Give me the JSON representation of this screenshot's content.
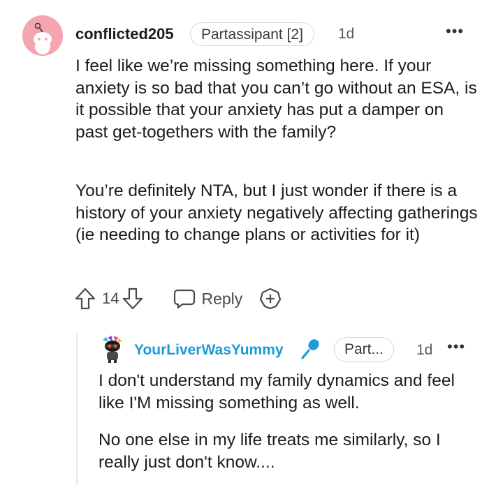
{
  "comment": {
    "username": "conflicted205",
    "flair": "Partassipant [2]",
    "time": "1d",
    "more": "•••",
    "paragraphs": [
      "I feel like we’re missing something here. If your anxiety is so bad that you can’t go without an ESA, is it possible that your anxiety has put a damper on past get-togethers with the family?",
      "You’re definitely NTA, but I just wonder if there is a history of your anxiety negatively affecting gatherings (ie needing to change plans or activities for it)"
    ],
    "vote_count": "14",
    "reply_label": "Reply",
    "icons": [
      "upvote-icon",
      "downvote-icon",
      "reply-bubble-icon",
      "award-icon"
    ]
  },
  "reply": {
    "username": "YourLiverWasYummy",
    "flair": "Part...",
    "time": "1d",
    "more": "•••",
    "paragraphs": [
      "I don't understand my family dynamics and feel like I'M missing something as well.",
      "No one else in my life treats me similarly, so I really just don't know...."
    ],
    "icons": [
      "avatar-icon",
      "microphone-icon"
    ]
  },
  "colors": {
    "avatar_bg": "#f4a5b0",
    "reply_username": "#1b9bd8",
    "text": "#1c1c1c",
    "muted": "#4a4a4a"
  }
}
